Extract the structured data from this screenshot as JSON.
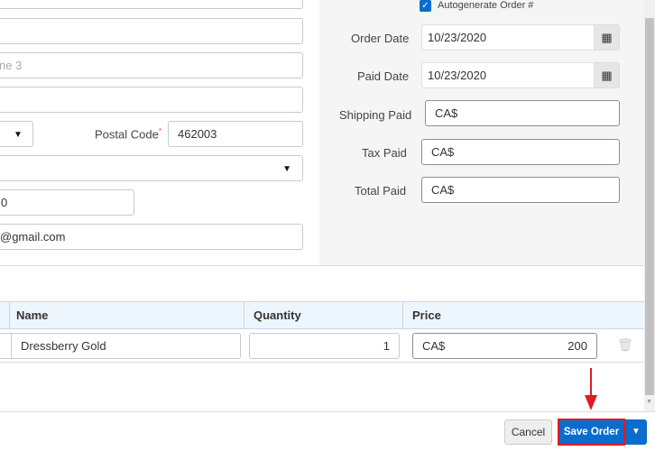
{
  "address": {
    "line2": "",
    "line3_placeholder": "ne 3",
    "line4": "",
    "postal_code_label": "Postal Code",
    "postal_code": "462003",
    "phone": "0",
    "email": "@gmail.com"
  },
  "order": {
    "autogenerate_label": "Autogenerate Order #",
    "autogenerate_checked": true,
    "order_date_label": "Order Date",
    "order_date": "10/23/2020",
    "paid_date_label": "Paid Date",
    "paid_date": "10/23/2020",
    "shipping_paid_label": "Shipping Paid",
    "tax_paid_label": "Tax Paid",
    "total_paid_label": "Total Paid",
    "currency": "CA$"
  },
  "table": {
    "headers": [
      "Name",
      "Quantity",
      "Price"
    ],
    "rows": [
      {
        "name": "Dressberry Gold",
        "quantity": "1",
        "currency": "CA$",
        "price": "200"
      }
    ]
  },
  "footer": {
    "cancel": "Cancel",
    "save": "Save Order"
  },
  "colors": {
    "primary": "#0a6ccd",
    "highlight": "#e21b23"
  }
}
